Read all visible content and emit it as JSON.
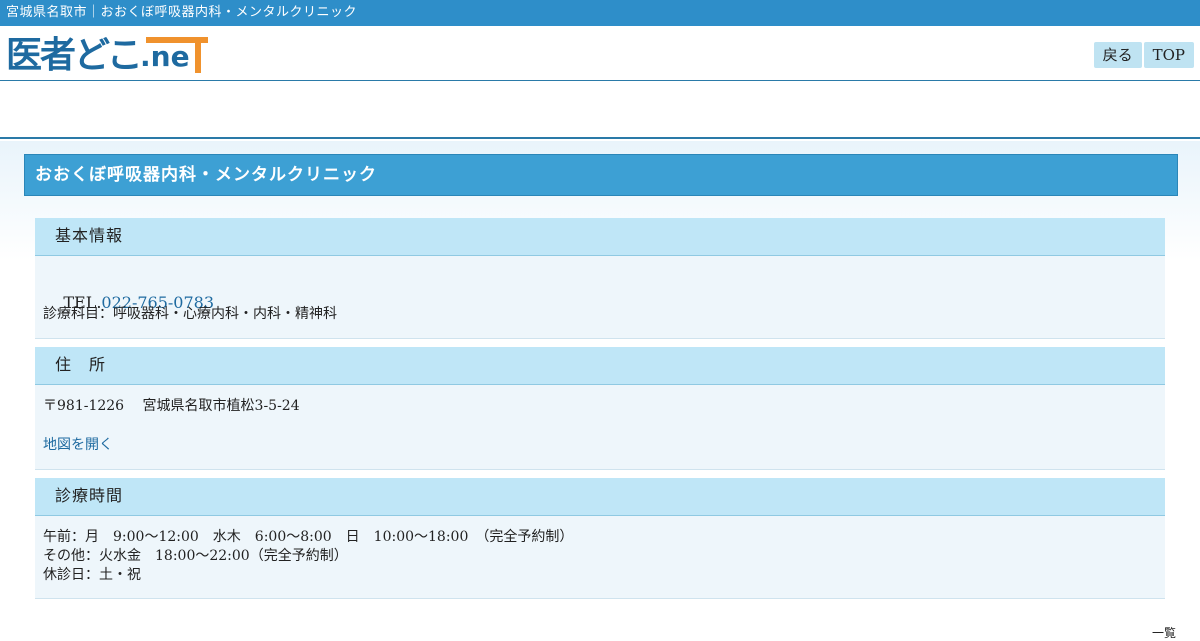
{
  "topbar": {
    "text": "宮城県名取市｜おおくぼ呼吸器内科・メンタルクリニック"
  },
  "logo": {
    "ja": "医者どこ",
    "net": ".ne"
  },
  "nav": {
    "back": "戻る",
    "top": "TOP"
  },
  "clinic": {
    "title": "おおくぼ呼吸器内科・メンタルクリニック"
  },
  "basic": {
    "heading": "基本情報",
    "tel_prefix": "TEL.",
    "tel": "022-765-0783",
    "departments": "診療科目：呼吸器科・心療内科・内科・精神科"
  },
  "address": {
    "heading": "住　所",
    "line": "〒981-1226　 宮城県名取市植松3-5-24",
    "map_link": "地図を開く"
  },
  "hours": {
    "heading": "診療時間",
    "lines": [
      "午前：月　9:00〜12:00　水木　6:00〜8:00　日　10:00〜18:00　（完全予約制）",
      "その他：火水金　18:00〜22:00（完全予約制）",
      "休診日：土・祝"
    ]
  },
  "footer": {
    "more": "一覧"
  }
}
